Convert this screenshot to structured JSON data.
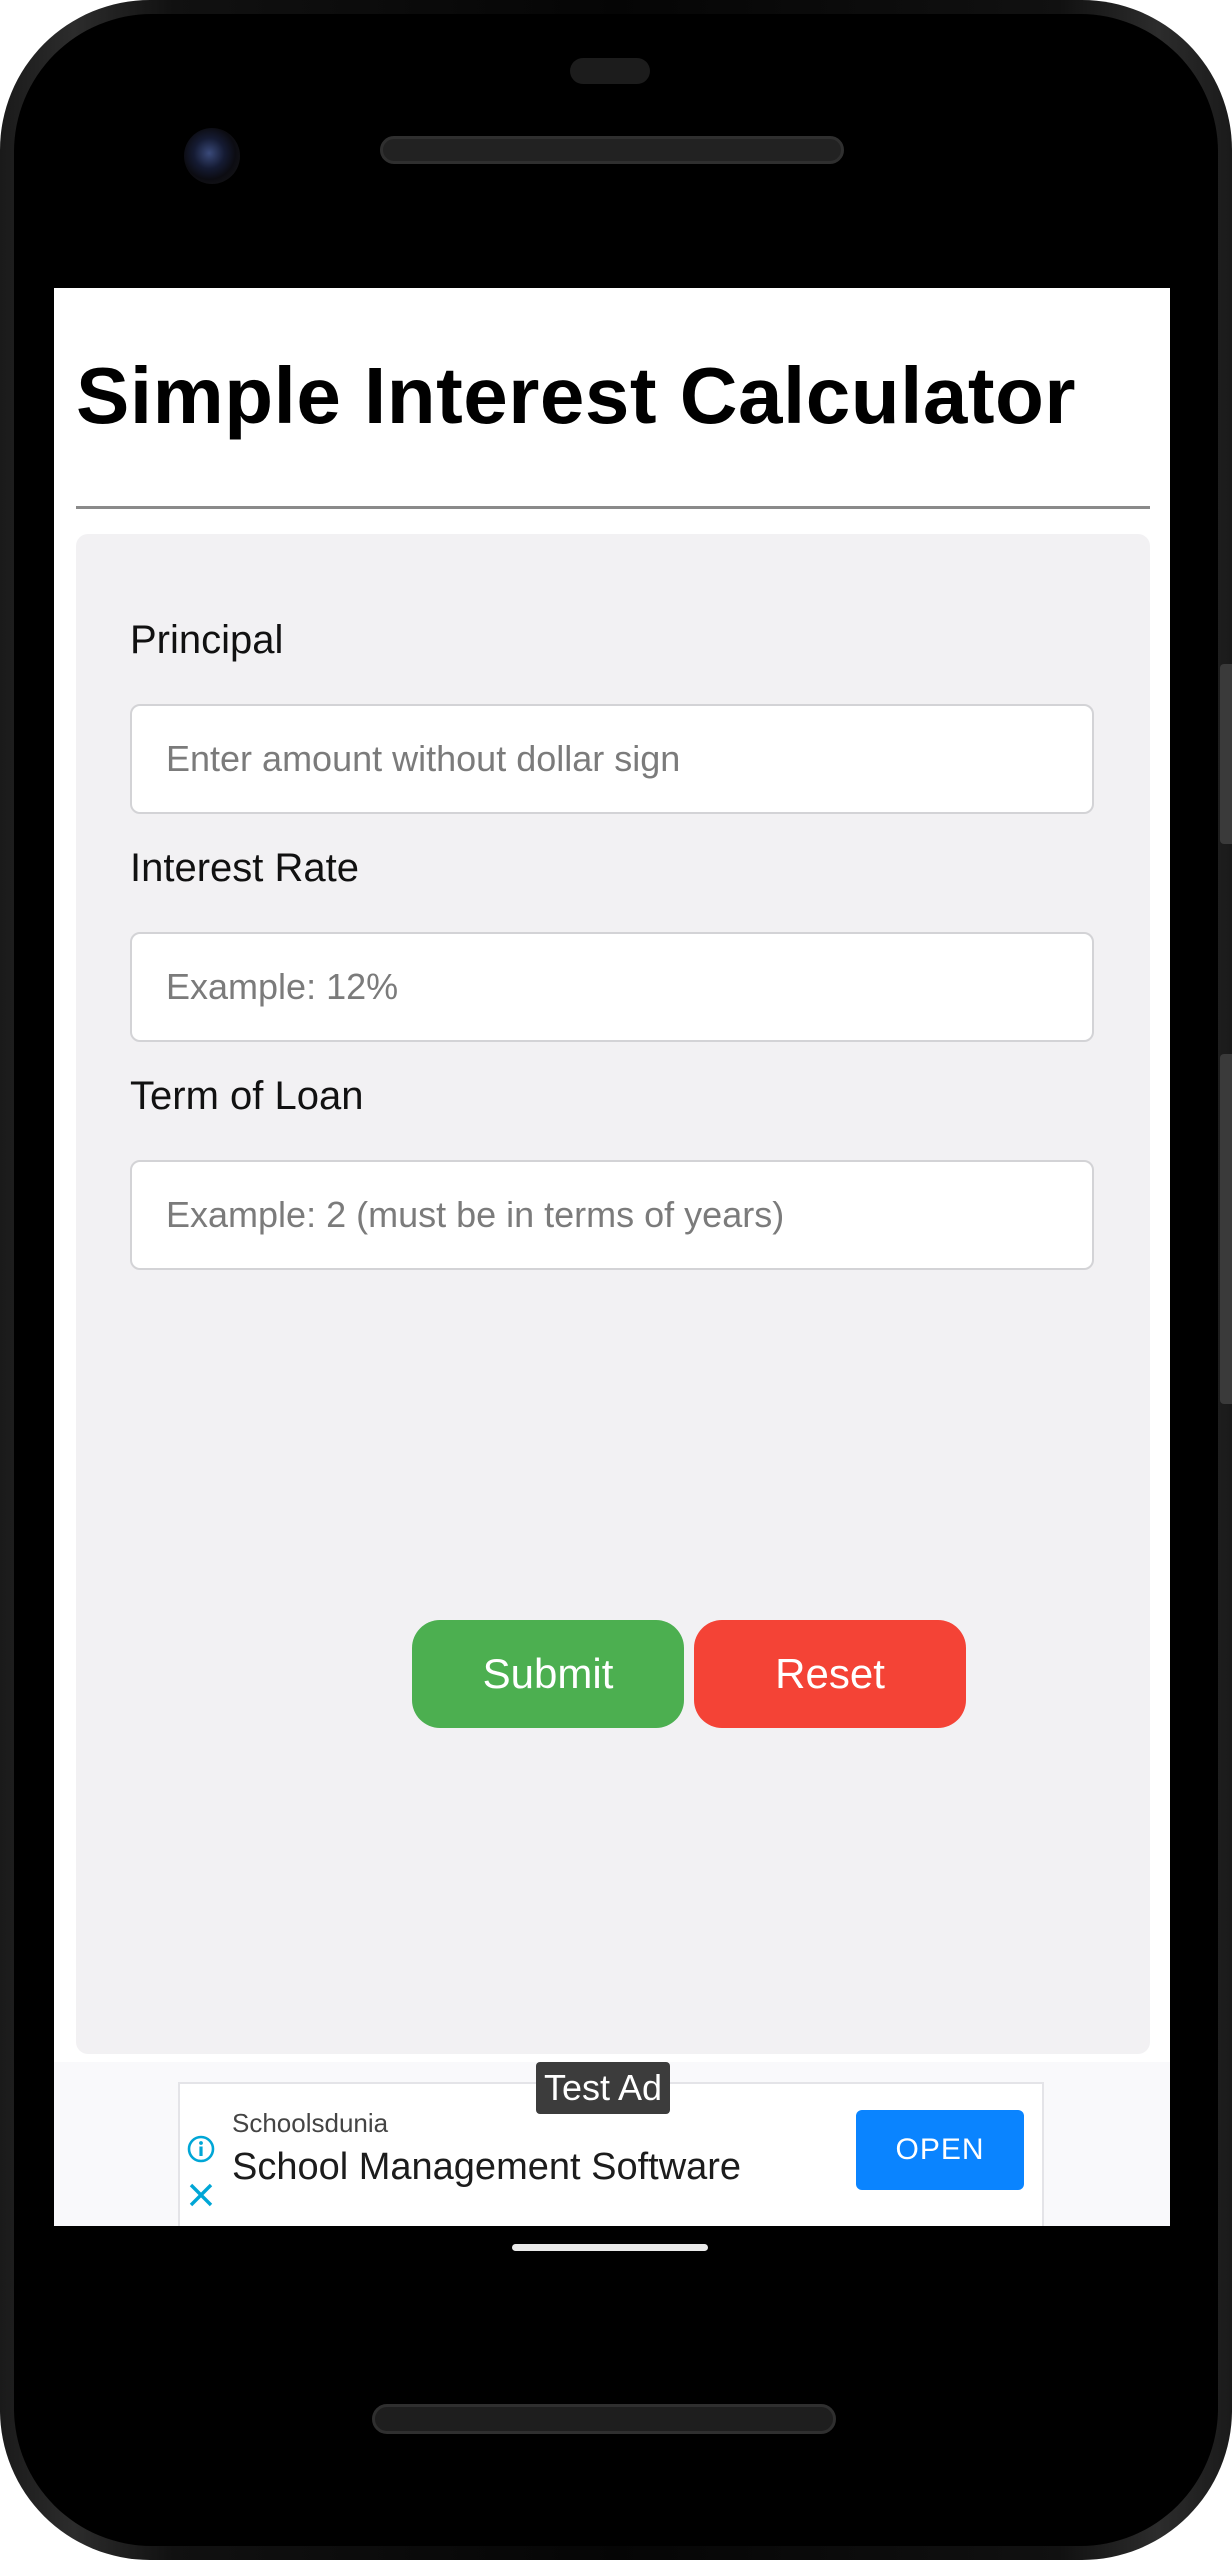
{
  "app": {
    "title": "Simple Interest Calculator"
  },
  "form": {
    "principal": {
      "label": "Principal",
      "placeholder": "Enter amount without dollar sign",
      "value": ""
    },
    "interest_rate": {
      "label": "Interest Rate",
      "placeholder": "Example: 12%",
      "value": ""
    },
    "term": {
      "label": "Term of Loan",
      "placeholder": "Example: 2 (must be in terms of years)",
      "value": ""
    },
    "submit_label": "Submit",
    "reset_label": "Reset"
  },
  "ad": {
    "badge": "Test Ad",
    "advertiser": "Schoolsdunia",
    "headline": "School Management Software",
    "cta": "OPEN",
    "info_icon": "info-icon",
    "close_icon": "close-icon"
  },
  "colors": {
    "submit": "#4caf50",
    "reset": "#f44336",
    "ad_cta": "#0a84ff",
    "ad_icons": "#00a6d6"
  }
}
